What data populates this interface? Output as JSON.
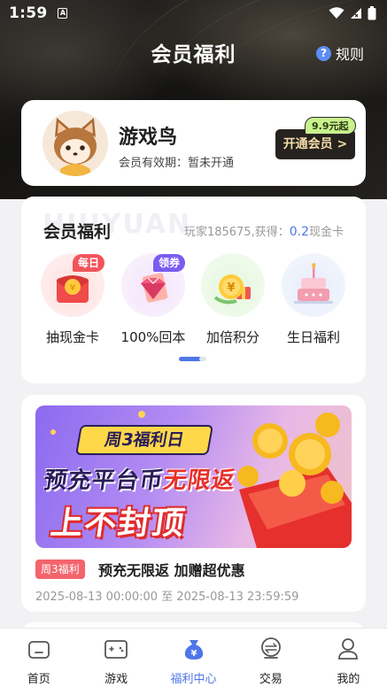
{
  "status_bar": {
    "time": "1:59",
    "a_icon_text": "A"
  },
  "header": {
    "title": "会员福利",
    "rules_label": "规则"
  },
  "member_card": {
    "name": "游戏鸟",
    "validity": "会员有效期：暂未开通",
    "open_button": "开通会员 >",
    "price_tag": "9.9元起"
  },
  "benefits": {
    "title": "会员福利",
    "watermark": "HUIYUAN",
    "stat_prefix": "玩家185675,获得：",
    "stat_value": "0.2",
    "stat_suffix": "现金卡",
    "items": [
      {
        "label": "抽现金卡",
        "badge": "每日",
        "badge_color": "#f2545b",
        "icon": "red-envelope-icon"
      },
      {
        "label": "100%回本",
        "badge": "领券",
        "badge_color": "#7a5cf0",
        "icon": "diamond-icon"
      },
      {
        "label": "加倍积分",
        "badge": "",
        "badge_color": "",
        "icon": "coin-gift-icon"
      },
      {
        "label": "生日福利",
        "badge": "",
        "badge_color": "",
        "icon": "birthday-cake-icon"
      }
    ]
  },
  "event": {
    "banner_tag": "周3福利日",
    "banner_line1_a": "预充平台币",
    "banner_line1_b": "无限返",
    "banner_line2": "上不封顶",
    "tag": "周3福利",
    "title": "预充无限返 加赠超优惠",
    "time": "2025-08-13 00:00:00 至 2025-08-13 23:59:59"
  },
  "tabbar": {
    "items": [
      {
        "label": "首页",
        "icon": "home-icon",
        "active": false
      },
      {
        "label": "游戏",
        "icon": "game-icon",
        "active": false
      },
      {
        "label": "福利中心",
        "icon": "welfare-bag-icon",
        "active": true
      },
      {
        "label": "交易",
        "icon": "trade-icon",
        "active": false
      },
      {
        "label": "我的",
        "icon": "profile-icon",
        "active": false
      }
    ]
  },
  "colors": {
    "accent": "#4f76e8",
    "dark_button": "#25221f",
    "gold_text": "#f4dca8"
  }
}
